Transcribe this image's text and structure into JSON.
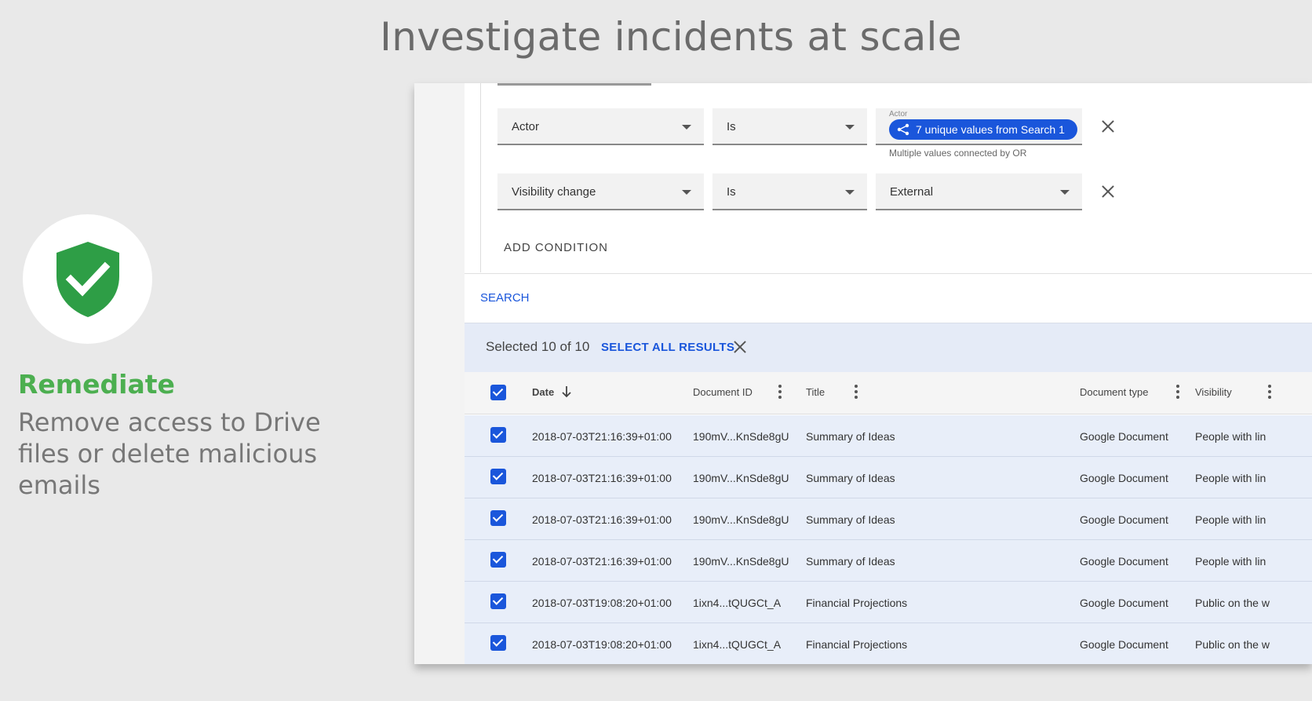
{
  "headline": "Investigate incidents at scale",
  "promo": {
    "icon": "shield-check-icon",
    "title": "Remediate",
    "text": "Remove access to Drive files or delete malicious emails",
    "accent": "#4caf50"
  },
  "filters": [
    {
      "field": "Actor",
      "operator": "Is",
      "value_label": "Actor",
      "chip": "7 unique values from Search 1",
      "helper": "Multiple values connected by OR"
    },
    {
      "field": "Visibility change",
      "operator": "Is",
      "value": "External"
    }
  ],
  "add_condition": "ADD CONDITION",
  "search": "SEARCH",
  "selection": {
    "text": "Selected 10 of 10",
    "select_all": "SELECT ALL RESULTS"
  },
  "columns": [
    "Date",
    "Document ID",
    "Title",
    "Document type",
    "Visibility"
  ],
  "rows": [
    {
      "date": "2018-07-03T21:16:39+01:00",
      "doc_id": "190mV...KnSde8gU",
      "title": "Summary of Ideas",
      "type": "Google Document",
      "visibility": "People with lin"
    },
    {
      "date": "2018-07-03T21:16:39+01:00",
      "doc_id": "190mV...KnSde8gU",
      "title": "Summary of Ideas",
      "type": "Google Document",
      "visibility": "People with lin"
    },
    {
      "date": "2018-07-03T21:16:39+01:00",
      "doc_id": "190mV...KnSde8gU",
      "title": "Summary of Ideas",
      "type": "Google Document",
      "visibility": "People with lin"
    },
    {
      "date": "2018-07-03T21:16:39+01:00",
      "doc_id": "190mV...KnSde8gU",
      "title": "Summary of Ideas",
      "type": "Google Document",
      "visibility": "People with lin"
    },
    {
      "date": "2018-07-03T19:08:20+01:00",
      "doc_id": "1ixn4...tQUGCt_A",
      "title": "Financial Projections",
      "type": "Google Document",
      "visibility": "Public on the w"
    },
    {
      "date": "2018-07-03T19:08:20+01:00",
      "doc_id": "1ixn4...tQUGCt_A",
      "title": "Financial Projections",
      "type": "Google Document",
      "visibility": "Public on the w"
    }
  ],
  "colors": {
    "primary": "#1a56db",
    "selection_bg": "#e5ebf7"
  }
}
